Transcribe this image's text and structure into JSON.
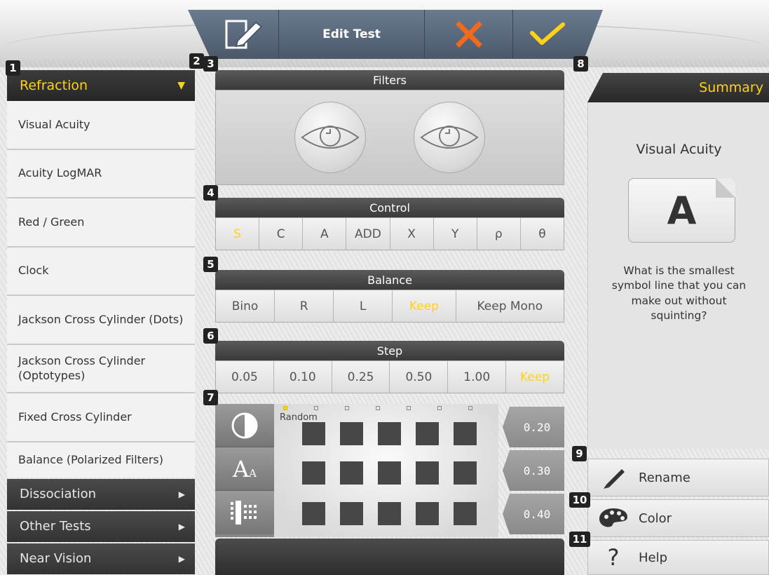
{
  "header": {
    "title": "Edit Test",
    "edit_icon": "edit-note-icon",
    "cancel_icon": "close-x-icon",
    "confirm_icon": "checkmark-icon",
    "accent": "#ffd21a",
    "cancel_color": "#f26a1b"
  },
  "badges": [
    "1",
    "2",
    "3",
    "4",
    "5",
    "6",
    "7",
    "8",
    "9",
    "10",
    "11"
  ],
  "left_menu": {
    "header": "Refraction",
    "items": [
      "Visual Acuity",
      "Acuity LogMAR",
      "Red / Green",
      "Clock",
      "Jackson Cross Cylinder (Dots)",
      "Jackson Cross Cylinder (Optotypes)",
      "Fixed Cross Cylinder",
      "Balance (Polarized Filters)"
    ],
    "categories": [
      "Dissociation",
      "Other Tests",
      "Near Vision"
    ]
  },
  "filters": {
    "title": "Filters",
    "eyes": [
      "eye-icon",
      "eye-icon"
    ]
  },
  "control": {
    "title": "Control",
    "buttons": [
      "S",
      "C",
      "A",
      "ADD",
      "X",
      "Y",
      "ρ",
      "θ"
    ],
    "active": "S"
  },
  "balance": {
    "title": "Balance",
    "buttons": [
      "Bino",
      "R",
      "L",
      "Keep",
      "Keep Mono"
    ],
    "active": "Keep"
  },
  "step": {
    "title": "Step",
    "buttons": [
      "0.05",
      "0.10",
      "0.25",
      "0.50",
      "1.00",
      "Keep"
    ],
    "active": "Keep"
  },
  "chart": {
    "random_label": "Random",
    "values": [
      "0.20",
      "0.30",
      "0.40"
    ],
    "side_buttons": [
      "contrast-icon",
      "font-size-icon",
      "grid-pattern-icon"
    ],
    "dots_active_index": 0
  },
  "summary": {
    "header": "Summary",
    "title": "Visual Acuity",
    "symbol": "A",
    "question": "What is the smallest symbol line that you can make out without squinting?"
  },
  "actions": [
    {
      "label": "Rename",
      "icon": "pencil-icon"
    },
    {
      "label": "Color",
      "icon": "palette-icon"
    },
    {
      "label": "Help",
      "icon": "question-mark-icon"
    }
  ]
}
